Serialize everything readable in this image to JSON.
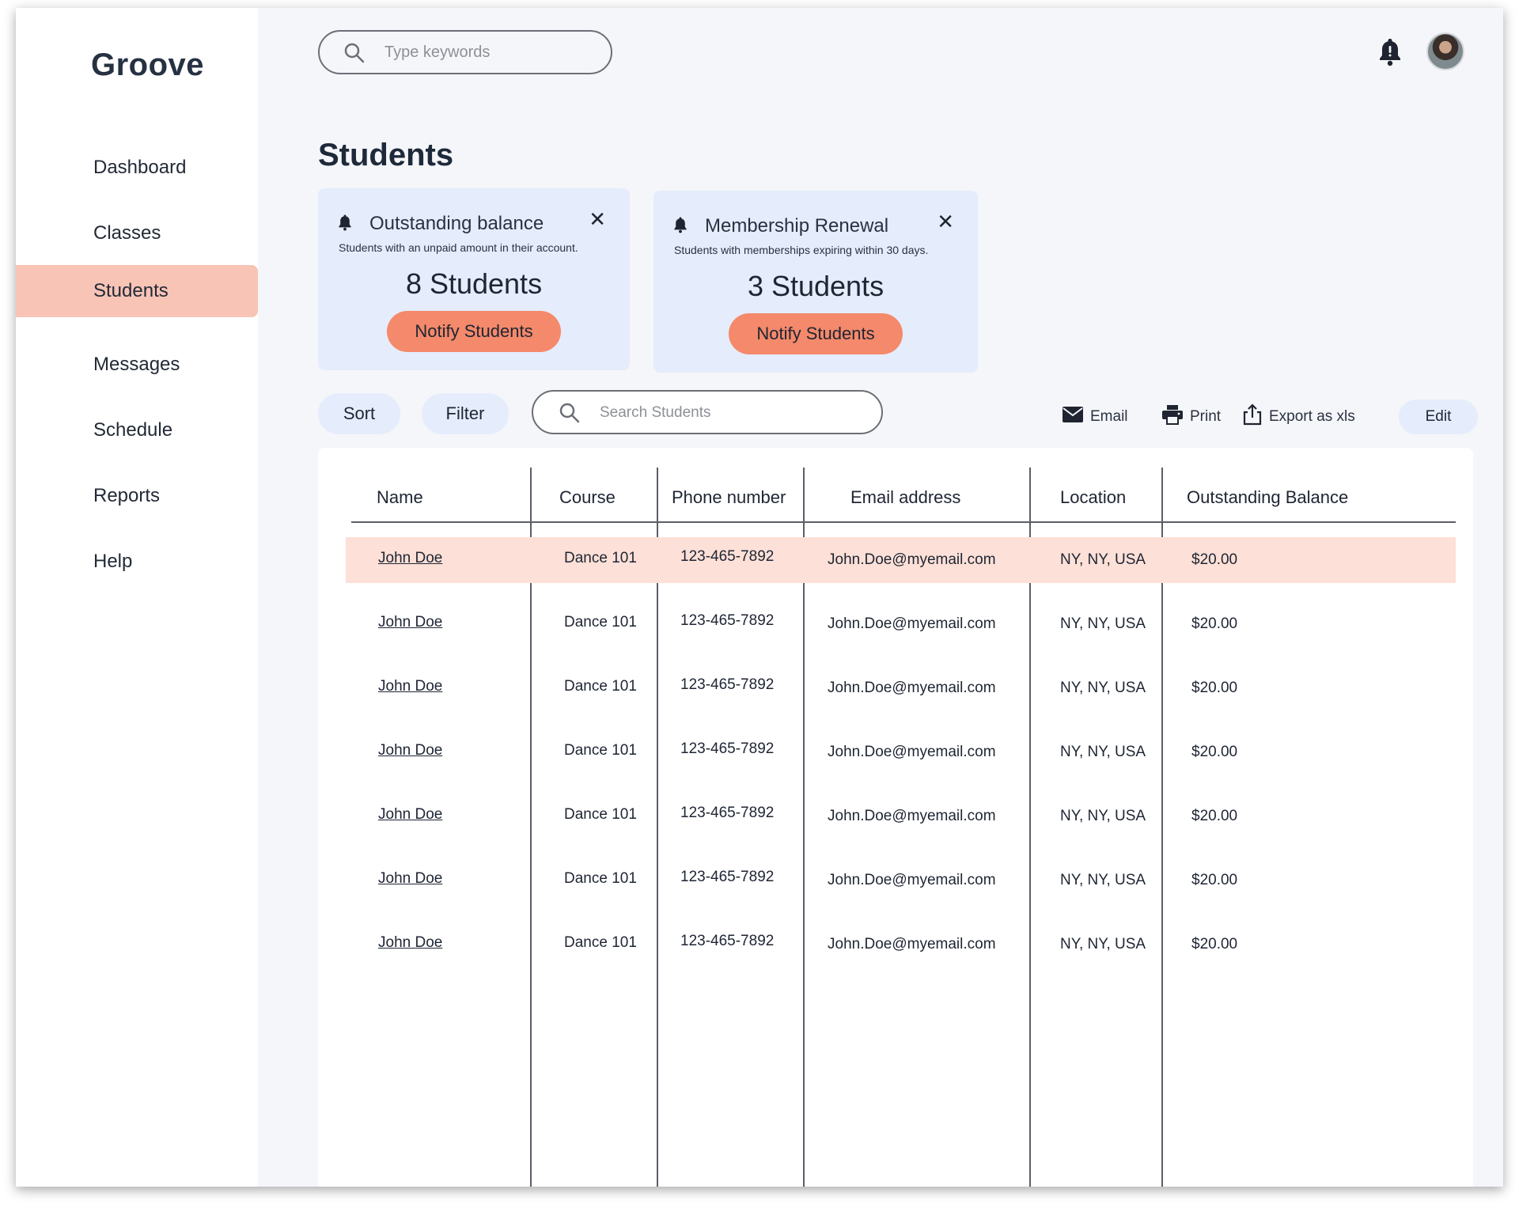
{
  "app": {
    "name": "Groove"
  },
  "sidebar": {
    "items": [
      {
        "label": "Dashboard",
        "active": false
      },
      {
        "label": "Classes",
        "active": false
      },
      {
        "label": "Students",
        "active": true
      },
      {
        "label": "Messages",
        "active": false
      },
      {
        "label": "Schedule",
        "active": false
      },
      {
        "label": "Reports",
        "active": false
      },
      {
        "label": "Help",
        "active": false
      }
    ]
  },
  "topbar": {
    "search_placeholder": "Type keywords",
    "icons": [
      "search-icon",
      "bell-icon",
      "avatar"
    ]
  },
  "page": {
    "title": "Students"
  },
  "cards": [
    {
      "title": "Outstanding balance",
      "subtitle": "Students with an unpaid amount in their account.",
      "count": "8 Students",
      "button": "Notify Students"
    },
    {
      "title": "Membership Renewal",
      "subtitle": "Students with memberships expiring within 30 days.",
      "count": "3 Students",
      "button": "Notify Students"
    }
  ],
  "toolbar": {
    "sort": "Sort",
    "filter": "Filter",
    "search_placeholder": "Search Students",
    "email": "Email",
    "print": "Print",
    "export": "Export as xls",
    "edit": "Edit"
  },
  "table": {
    "headers": [
      "Name",
      "Course",
      "Phone number",
      "Email address",
      "Location",
      "Outstanding Balance"
    ],
    "rows": [
      {
        "name": "John Doe",
        "course": "Dance 101",
        "phone": "123-465-7892",
        "email": "John.Doe@myemail.com",
        "location": "NY, NY, USA",
        "balance": "$20.00",
        "highlighted": true
      },
      {
        "name": "John Doe",
        "course": "Dance 101",
        "phone": "123-465-7892",
        "email": "John.Doe@myemail.com",
        "location": "NY, NY, USA",
        "balance": "$20.00",
        "highlighted": false
      },
      {
        "name": "John Doe",
        "course": "Dance 101",
        "phone": "123-465-7892",
        "email": "John.Doe@myemail.com",
        "location": "NY, NY, USA",
        "balance": "$20.00",
        "highlighted": false
      },
      {
        "name": "John Doe",
        "course": "Dance 101",
        "phone": "123-465-7892",
        "email": "John.Doe@myemail.com",
        "location": "NY, NY, USA",
        "balance": "$20.00",
        "highlighted": false
      },
      {
        "name": "John Doe",
        "course": "Dance 101",
        "phone": "123-465-7892",
        "email": "John.Doe@myemail.com",
        "location": "NY, NY, USA",
        "balance": "$20.00",
        "highlighted": false
      },
      {
        "name": "John Doe",
        "course": "Dance 101",
        "phone": "123-465-7892",
        "email": "John.Doe@myemail.com",
        "location": "NY, NY, USA",
        "balance": "$20.00",
        "highlighted": false
      },
      {
        "name": "John Doe",
        "course": "Dance 101",
        "phone": "123-465-7892",
        "email": "John.Doe@myemail.com",
        "location": "NY, NY, USA",
        "balance": "$20.00",
        "highlighted": false
      }
    ]
  },
  "colors": {
    "accent": "#f4896b",
    "active_nav": "#f7c4b6",
    "card_bg": "#e5ecfb",
    "row_highlight": "#fde0d7",
    "page_bg": "#f5f6fa"
  }
}
